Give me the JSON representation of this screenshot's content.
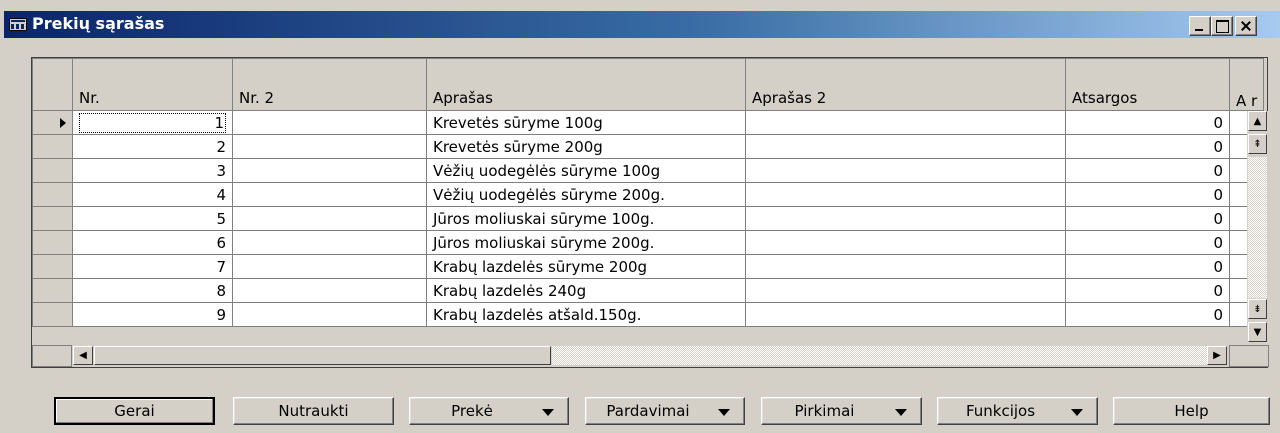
{
  "window": {
    "title": "Prekių sąrašas",
    "controls": [
      "minimize",
      "maximize",
      "close"
    ]
  },
  "grid": {
    "columns": [
      "Nr.",
      "Nr. 2",
      "Aprašas",
      "Aprašas 2",
      "Atsargos",
      "A r"
    ],
    "rows": [
      {
        "nr": "1",
        "nr2": "",
        "aprasas": "Krevetės sūryme 100g",
        "aprasas2": "",
        "atsargos": "0"
      },
      {
        "nr": "2",
        "nr2": "",
        "aprasas": "Krevetės sūryme 200g",
        "aprasas2": "",
        "atsargos": "0"
      },
      {
        "nr": "3",
        "nr2": "",
        "aprasas": "Vėžių uodegėlės sūryme 100g",
        "aprasas2": "",
        "atsargos": "0"
      },
      {
        "nr": "4",
        "nr2": "",
        "aprasas": "Vėžių uodegėlės sūryme 200g.",
        "aprasas2": "",
        "atsargos": "0"
      },
      {
        "nr": "5",
        "nr2": "",
        "aprasas": "Jūros moliuskai sūryme 100g.",
        "aprasas2": "",
        "atsargos": "0"
      },
      {
        "nr": "6",
        "nr2": "",
        "aprasas": "Jūros moliuskai sūryme 200g.",
        "aprasas2": "",
        "atsargos": "0"
      },
      {
        "nr": "7",
        "nr2": "",
        "aprasas": "Krabų lazdelės sūryme 200g",
        "aprasas2": "",
        "atsargos": "0"
      },
      {
        "nr": "8",
        "nr2": "",
        "aprasas": "Krabų lazdelės 240g",
        "aprasas2": "",
        "atsargos": "0"
      },
      {
        "nr": "9",
        "nr2": "",
        "aprasas": "Krabų lazdelės atšald.150g.",
        "aprasas2": "",
        "atsargos": "0"
      }
    ],
    "current_row_index": 0
  },
  "buttons": {
    "gerai": "Gerai",
    "nutraukti": "Nutraukti",
    "preke": "Prekė",
    "pardavimai": "Pardavimai",
    "pirkimai": "Pirkimai",
    "funkcijos": "Funkcijos",
    "help": "Help"
  },
  "icons": {
    "window": "grid-window-icon",
    "row_pointer": "row-pointer-icon",
    "scroll_up": "triangle-up-icon",
    "page_up": "double-up-icon",
    "page_down": "double-down-icon",
    "scroll_down": "triangle-down-icon",
    "scroll_left": "triangle-left-icon",
    "scroll_right": "triangle-right-icon",
    "dropdown": "caret-down-icon"
  },
  "colors": {
    "face": "#d4d0c8",
    "title_start": "#0a246a",
    "title_end": "#a6caf0",
    "cell_bg": "#ffffff"
  }
}
